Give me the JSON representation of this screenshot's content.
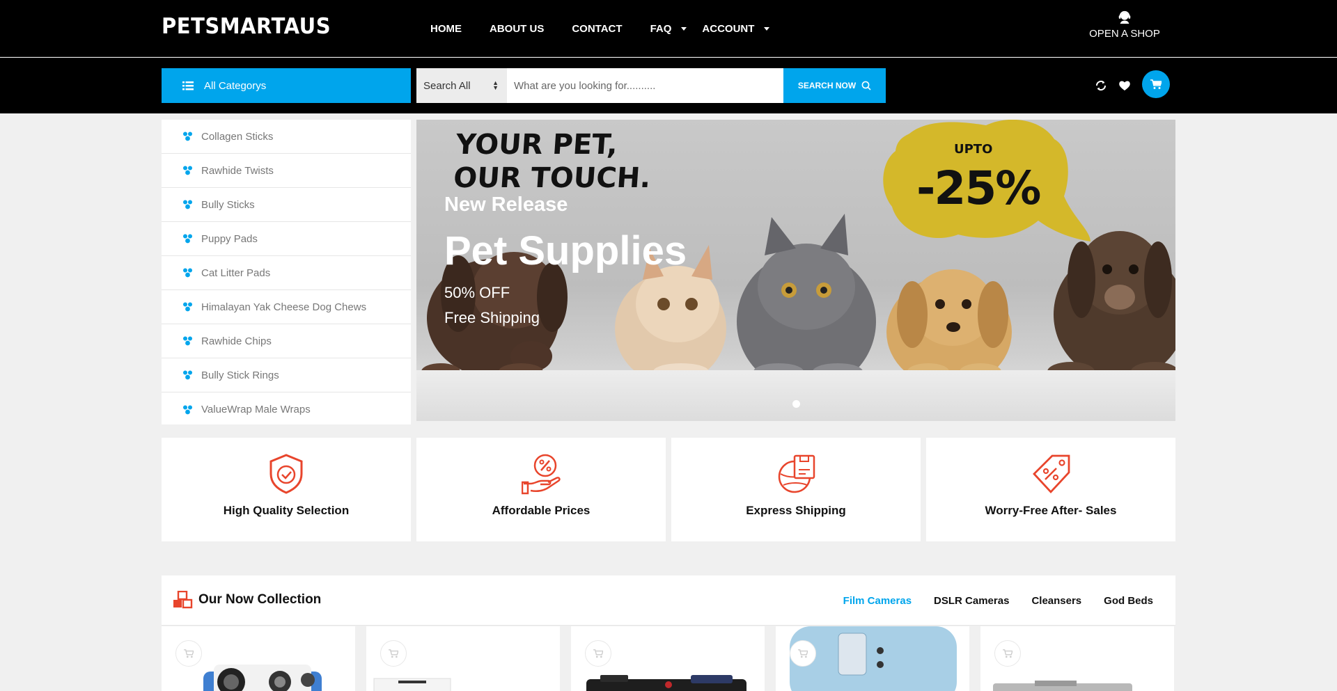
{
  "brand": {
    "logo": "PETSMARTAUS"
  },
  "nav": {
    "home": "HOME",
    "about": "ABOUT US",
    "contact": "CONTACT",
    "faq": "FAQ",
    "account": "ACCOUNT"
  },
  "open_shop": {
    "label": "OPEN A SHOP",
    "icon": "support-agent-icon"
  },
  "search": {
    "all_category": "All Categorys",
    "scope": "Search All",
    "placeholder": "What are you looking for..........",
    "button": "SEARCH NOW"
  },
  "categories": [
    "Collagen Sticks",
    "Rawhide Twists",
    "Bully Sticks",
    "Puppy Pads",
    "Cat Litter Pads",
    "Himalayan Yak Cheese Dog Chews",
    "Rawhide Chips",
    "Bully Stick Rings",
    "ValueWrap Male Wraps"
  ],
  "banner": {
    "tagline_1": "YOUR PET,",
    "tagline_2": "OUR TOUCH.",
    "subtitle": "New Release",
    "title": "Pet Supplies",
    "line_1": "50% OFF",
    "line_2": "Free Shipping",
    "bubble_top": "UPTO",
    "bubble_value": "-25%",
    "bubble_color": "#d4b82a",
    "slide_count": 1
  },
  "features": [
    {
      "title": "High Quality Selection",
      "icon": "shield-check-icon"
    },
    {
      "title": "Affordable Prices",
      "icon": "hand-percent-icon"
    },
    {
      "title": "Express Shipping",
      "icon": "globe-box-icon"
    },
    {
      "title": "Worry-Free After- Sales",
      "icon": "price-tag-icon"
    }
  ],
  "collection": {
    "title": "Our Now Collection",
    "tabs": [
      "Film Cameras",
      "DSLR Cameras",
      "Cleansers",
      "God Beds"
    ],
    "active_tab": "Film Cameras"
  },
  "colors": {
    "accent": "#00a5ec",
    "feature_icon": "#e8452c",
    "topbar": "#000000"
  }
}
